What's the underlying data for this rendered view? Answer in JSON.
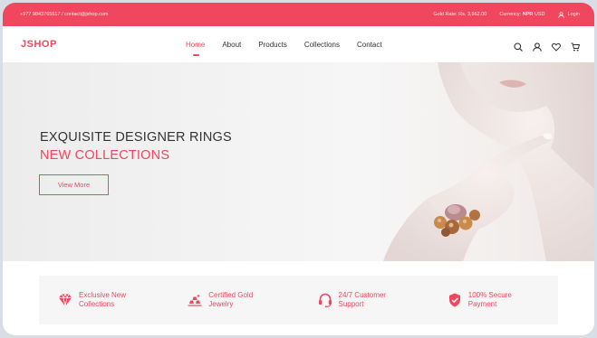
{
  "topbar": {
    "contact": "+977 9843765617 / contact@jshop.com",
    "gold_rate": "Gold Rate: Rs. 3,962.00",
    "currency_label": "Currency:",
    "currency_selected": "NPR",
    "currency_other": "USD",
    "login": "Login"
  },
  "brand": {
    "logo": "JSHOP"
  },
  "nav": {
    "items": [
      {
        "label": "Home",
        "active": true
      },
      {
        "label": "About"
      },
      {
        "label": "Products"
      },
      {
        "label": "Collections"
      },
      {
        "label": "Contact"
      }
    ],
    "icons": [
      "search-icon",
      "user-icon",
      "heart-icon",
      "cart-icon"
    ]
  },
  "hero": {
    "title": "EXQUISITE DESIGNER RINGS",
    "subtitle": "NEW COLLECTIONS",
    "button": "View More"
  },
  "features": [
    {
      "icon": "diamond-icon",
      "text": "Exclusive New Collections"
    },
    {
      "icon": "gold-bars-icon",
      "text": "Certified Gold Jewelry"
    },
    {
      "icon": "headset-icon",
      "text": "24/7 Customer Support"
    },
    {
      "icon": "shield-check-icon",
      "text": "100% Secure Payment"
    }
  ],
  "colors": {
    "accent": "#f0465e",
    "text_dark": "#333333"
  }
}
